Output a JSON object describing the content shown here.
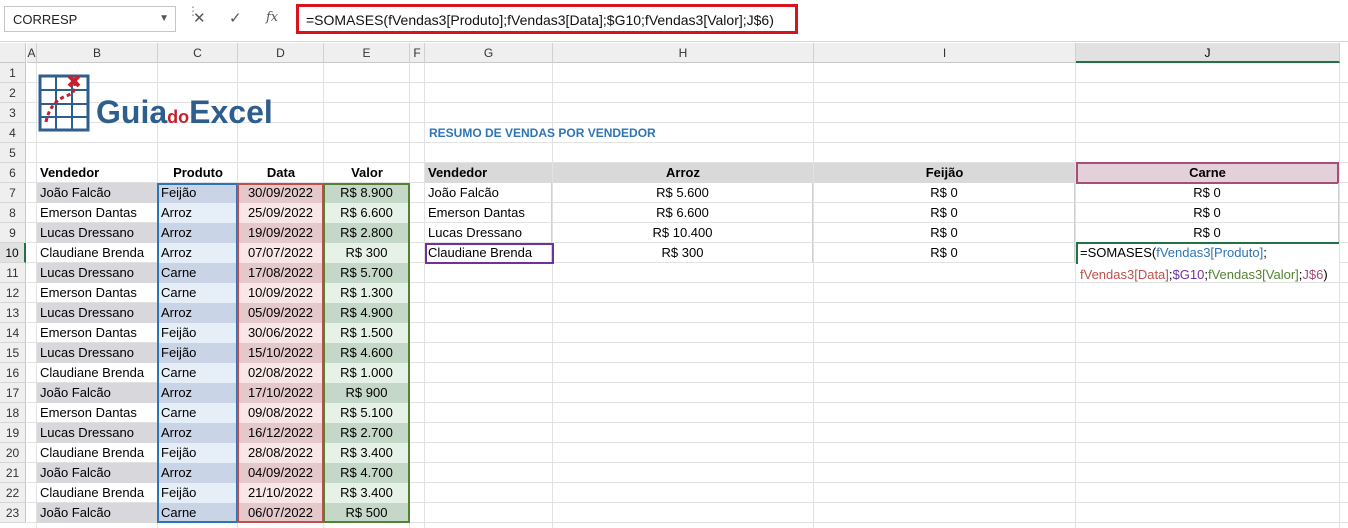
{
  "namebox": {
    "value": "CORRESP"
  },
  "formula_bar": {
    "formula": "=SOMASES(fVendas3[Produto];fVendas3[Data];$G10;fVendas3[Valor];J$6)"
  },
  "columns": [
    "A",
    "B",
    "C",
    "D",
    "E",
    "F",
    "G",
    "H",
    "I",
    "J"
  ],
  "rows": [
    "1",
    "2",
    "3",
    "4",
    "5",
    "6",
    "7",
    "8",
    "9",
    "10",
    "11",
    "12",
    "13",
    "14",
    "15",
    "16",
    "17",
    "18",
    "19",
    "20",
    "21",
    "22",
    "23"
  ],
  "logo": {
    "text_guia": "Guia",
    "text_do": "do",
    "text_excel": "Excel"
  },
  "sales_table": {
    "headers": [
      "Vendedor",
      "Produto",
      "Data",
      "Valor"
    ],
    "rows": [
      [
        "João Falcão",
        "Feijão",
        "30/09/2022",
        "R$ 8.900"
      ],
      [
        "Emerson Dantas",
        "Arroz",
        "25/09/2022",
        "R$ 6.600"
      ],
      [
        "Lucas Dressano",
        "Arroz",
        "19/09/2022",
        "R$ 2.800"
      ],
      [
        "Claudiane Brenda",
        "Arroz",
        "07/07/2022",
        "R$ 300"
      ],
      [
        "Lucas Dressano",
        "Carne",
        "17/08/2022",
        "R$ 5.700"
      ],
      [
        "Emerson Dantas",
        "Carne",
        "10/09/2022",
        "R$ 1.300"
      ],
      [
        "Lucas Dressano",
        "Arroz",
        "05/09/2022",
        "R$ 4.900"
      ],
      [
        "Emerson Dantas",
        "Feijão",
        "30/06/2022",
        "R$ 1.500"
      ],
      [
        "Lucas Dressano",
        "Feijão",
        "15/10/2022",
        "R$ 4.600"
      ],
      [
        "Claudiane Brenda",
        "Carne",
        "02/08/2022",
        "R$ 1.000"
      ],
      [
        "João Falcão",
        "Arroz",
        "17/10/2022",
        "R$ 900"
      ],
      [
        "Emerson Dantas",
        "Carne",
        "09/08/2022",
        "R$ 5.100"
      ],
      [
        "Lucas Dressano",
        "Arroz",
        "16/12/2022",
        "R$ 2.700"
      ],
      [
        "Claudiane Brenda",
        "Feijão",
        "28/08/2022",
        "R$ 3.400"
      ],
      [
        "João Falcão",
        "Arroz",
        "04/09/2022",
        "R$ 4.700"
      ],
      [
        "Claudiane Brenda",
        "Feijão",
        "21/10/2022",
        "R$ 3.400"
      ],
      [
        "João Falcão",
        "Carne",
        "06/07/2022",
        "R$ 500"
      ]
    ]
  },
  "summary": {
    "title": "RESUMO DE VENDAS POR VENDEDOR",
    "headers": [
      "Vendedor",
      "Arroz",
      "Feijão",
      "Carne"
    ],
    "rows": [
      [
        "João Falcão",
        "R$ 5.600",
        "R$ 0",
        "R$ 0"
      ],
      [
        "Emerson Dantas",
        "R$ 6.600",
        "R$ 0",
        "R$ 0"
      ],
      [
        "Lucas Dressano",
        "R$ 10.400",
        "R$ 0",
        "R$ 0"
      ],
      [
        "Claudiane Brenda",
        "R$ 300",
        "R$ 0",
        ""
      ]
    ],
    "editing": {
      "line1_prefix": "=SOMASES(",
      "line1_ref": "fVendas3[Produto]",
      "line1_suffix": ";",
      "line2_ref_data": "fVendas3[Data]",
      "sep1": ";",
      "line2_ref_g10": "$G10",
      "sep2": ";",
      "line2_ref_valor": "fVendas3[Valor]",
      "sep3": ";",
      "line2_ref_j6": "J$6",
      "line2_close": ")"
    }
  },
  "colors": {
    "formula_border": "#d9131b",
    "ref_produto": "#2e75b6",
    "ref_data": "#c0504d",
    "ref_g10": "#7030a0",
    "ref_valor": "#548235",
    "ref_j6": "#a64d79",
    "title_blue": "#2e75b6",
    "excel_green": "#217346"
  }
}
